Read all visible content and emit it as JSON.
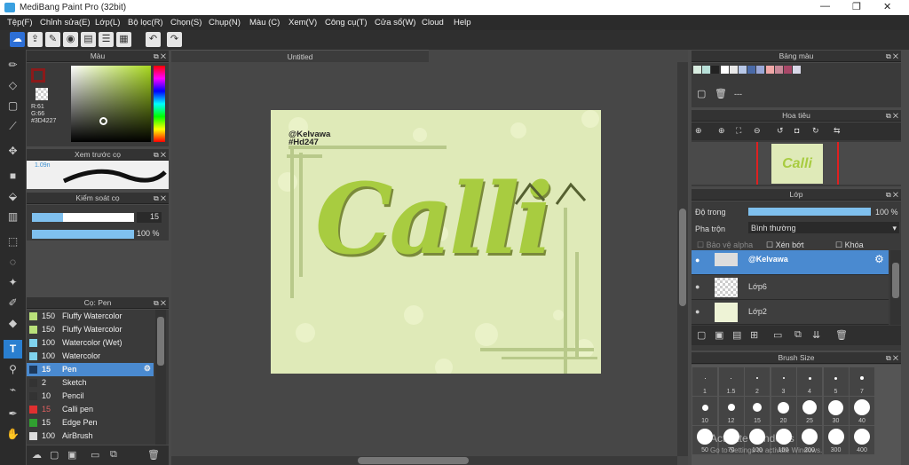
{
  "window": {
    "title": "MediBang Paint Pro (32bit)",
    "min": "—",
    "max": "❐",
    "close": "✕"
  },
  "menu": [
    "Tệp(F)",
    "Chỉnh sửa(E)",
    "Lớp(L)",
    "Bộ lọc(R)",
    "Chọn(S)",
    "Chụp(N)",
    "Màu (C)",
    "Xem(V)",
    "Công cụ(T)",
    "Cửa sổ(W)",
    "Cloud",
    "Help"
  ],
  "color_panel": {
    "title": "Màu",
    "r": "R:61",
    "g": "G:66",
    "b": "B:227",
    "hex": "#3D4227",
    "fg": "#8b1a1a"
  },
  "preview_panel": {
    "title": "Xem trước cọ",
    "size": "1.09n"
  },
  "control_panel": {
    "title": "Kiểm soát cọ",
    "size": "15",
    "opacity": "100 %",
    "size_frac": 0.3,
    "opacity_frac": 1.0
  },
  "brush_panel": {
    "title": "Cọ: Pen",
    "items": [
      {
        "size": "150",
        "name": "Fluffy Watercolor",
        "color": "#b9e07a"
      },
      {
        "size": "150",
        "name": "Fluffy Watercolor",
        "color": "#b9e07a"
      },
      {
        "size": "100",
        "name": "Watercolor (Wet)",
        "color": "#7fd3ee"
      },
      {
        "size": "100",
        "name": "Watercolor",
        "color": "#7fd3ee"
      },
      {
        "size": "15",
        "name": "Pen",
        "color": "#1e3a5c"
      },
      {
        "size": "2",
        "name": "Sketch",
        "color": "#333"
      },
      {
        "size": "10",
        "name": "Pencil",
        "color": "#333"
      },
      {
        "size": "15",
        "name": "Calli pen",
        "color": "#e03030"
      },
      {
        "size": "15",
        "name": "Edge Pen",
        "color": "#30a030"
      },
      {
        "size": "100",
        "name": "AirBrush",
        "color": "#ddd"
      }
    ]
  },
  "canvas": {
    "tab": "Untitled",
    "credit1": "@Kelvawa",
    "credit2": "#Hd247",
    "art_text": "Calli"
  },
  "palette_panel": {
    "title": "Bảng màu",
    "swatches": [
      "#d8ece0",
      "#b8e0d8",
      "#222222",
      "#ffffff",
      "#e8e8e8",
      "#b8c8e8",
      "#4a6aa8",
      "#9aa8d8",
      "#f0a8a8",
      "#c88898",
      "#a84868",
      "#d8d8e8"
    ],
    "label": "---"
  },
  "navigator_panel": {
    "title": "Hoa tiêu"
  },
  "layer_panel": {
    "title": "Lớp",
    "opacity_label": "Độ trong",
    "opacity": "100 %",
    "blend_label": "Pha trộn",
    "blend": "Bình thường",
    "alpha": "Bảo vệ alpha",
    "clip": "Xén bớt",
    "lock": "Khóa",
    "layers": [
      {
        "name": "@Kelvawa"
      },
      {
        "name": "Lớp6"
      },
      {
        "name": "Lớp2"
      }
    ]
  },
  "brush_size_panel": {
    "title": "Brush Size",
    "row1": [
      "1",
      "1.5",
      "2",
      "3",
      "4",
      "5",
      "7"
    ],
    "row2": [
      "10",
      "12",
      "15",
      "20",
      "25",
      "30",
      "40"
    ],
    "row3": [
      "50",
      "70",
      "100",
      "150",
      "200",
      "300",
      "400"
    ]
  },
  "watermark": {
    "l1": "Activate Windows",
    "l2": "Go to Settings to activate Windows."
  }
}
